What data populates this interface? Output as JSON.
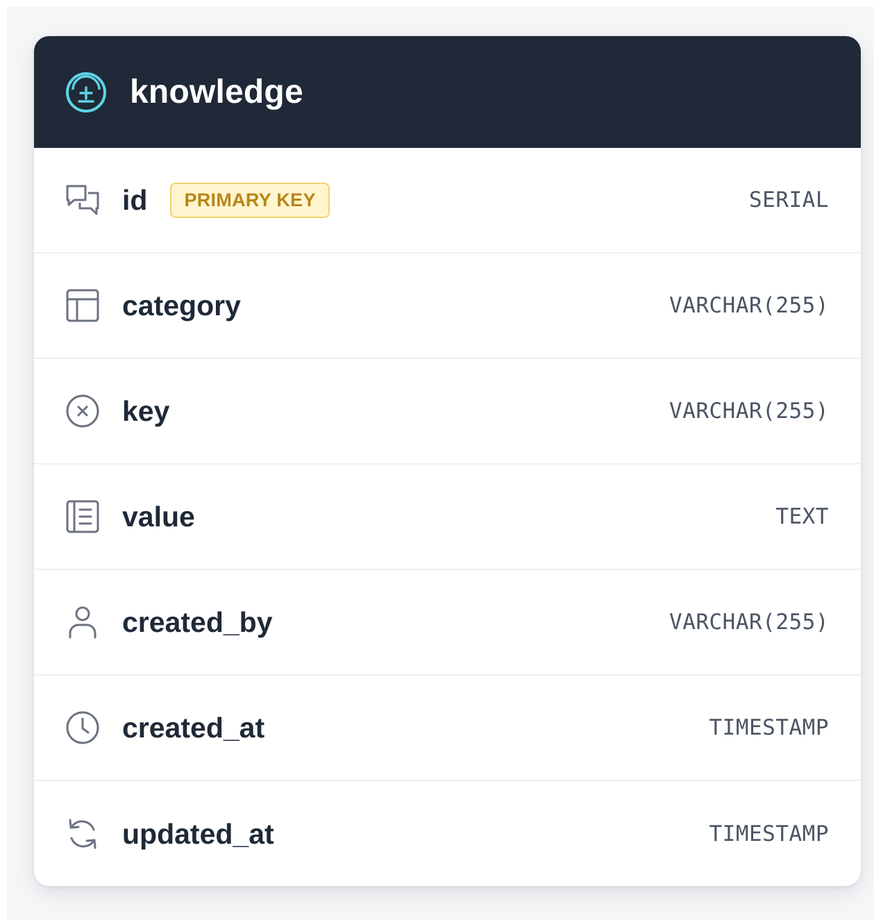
{
  "table": {
    "name": "knowledge",
    "icon": "database-icon",
    "header_color": "#1f2937",
    "accent_color": "#5ed3e6"
  },
  "columns": [
    {
      "name": "id",
      "type": "SERIAL",
      "badge": "PRIMARY KEY",
      "icon": "chat-bubbles-icon"
    },
    {
      "name": "category",
      "type": "VARCHAR(255)",
      "icon": "layout-icon"
    },
    {
      "name": "key",
      "type": "VARCHAR(255)",
      "icon": "x-circle-icon"
    },
    {
      "name": "value",
      "type": "TEXT",
      "icon": "document-list-icon"
    },
    {
      "name": "created_by",
      "type": "VARCHAR(255)",
      "icon": "user-icon"
    },
    {
      "name": "created_at",
      "type": "TIMESTAMP",
      "icon": "clock-icon"
    },
    {
      "name": "updated_at",
      "type": "TIMESTAMP",
      "icon": "refresh-icon"
    }
  ]
}
